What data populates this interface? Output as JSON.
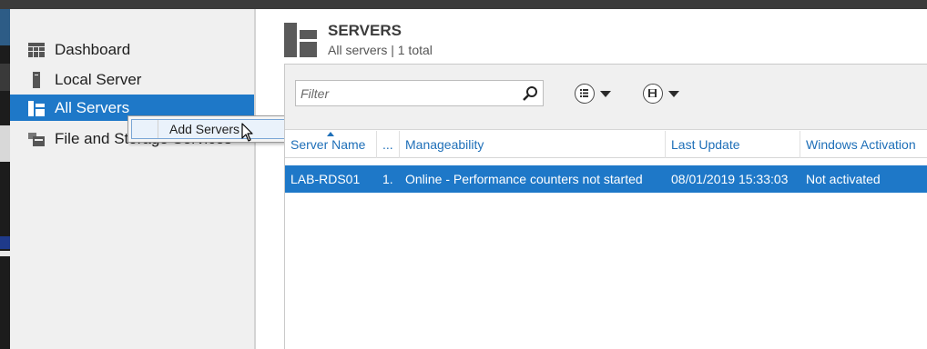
{
  "nav": {
    "items": [
      {
        "label": "Dashboard",
        "icon": "dashboard-icon"
      },
      {
        "label": "Local Server",
        "icon": "server-icon"
      },
      {
        "label": "All Servers",
        "icon": "all-servers-icon",
        "selected": true
      },
      {
        "label": "File and Storage Services",
        "icon": "storage-icon"
      }
    ]
  },
  "context_menu": {
    "items": [
      {
        "label": "Add Servers"
      }
    ]
  },
  "header": {
    "title": "SERVERS",
    "subtitle": "All servers | 1 total"
  },
  "toolbar": {
    "filter_placeholder": "Filter",
    "buttons": [
      {
        "icon": "list-options-icon"
      },
      {
        "icon": "save-query-icon"
      }
    ]
  },
  "table": {
    "columns": [
      "Server Name",
      "...",
      "Manageability",
      "Last Update",
      "Windows Activation"
    ],
    "rows": [
      [
        "LAB-RDS01",
        "1.",
        "Online - Performance counters not started",
        "08/01/2019 15:33:03",
        "Not activated"
      ]
    ]
  },
  "colors": {
    "accent": "#1e78c8",
    "header_link": "#1e6fb8",
    "nav_background": "#f0f0f0"
  }
}
